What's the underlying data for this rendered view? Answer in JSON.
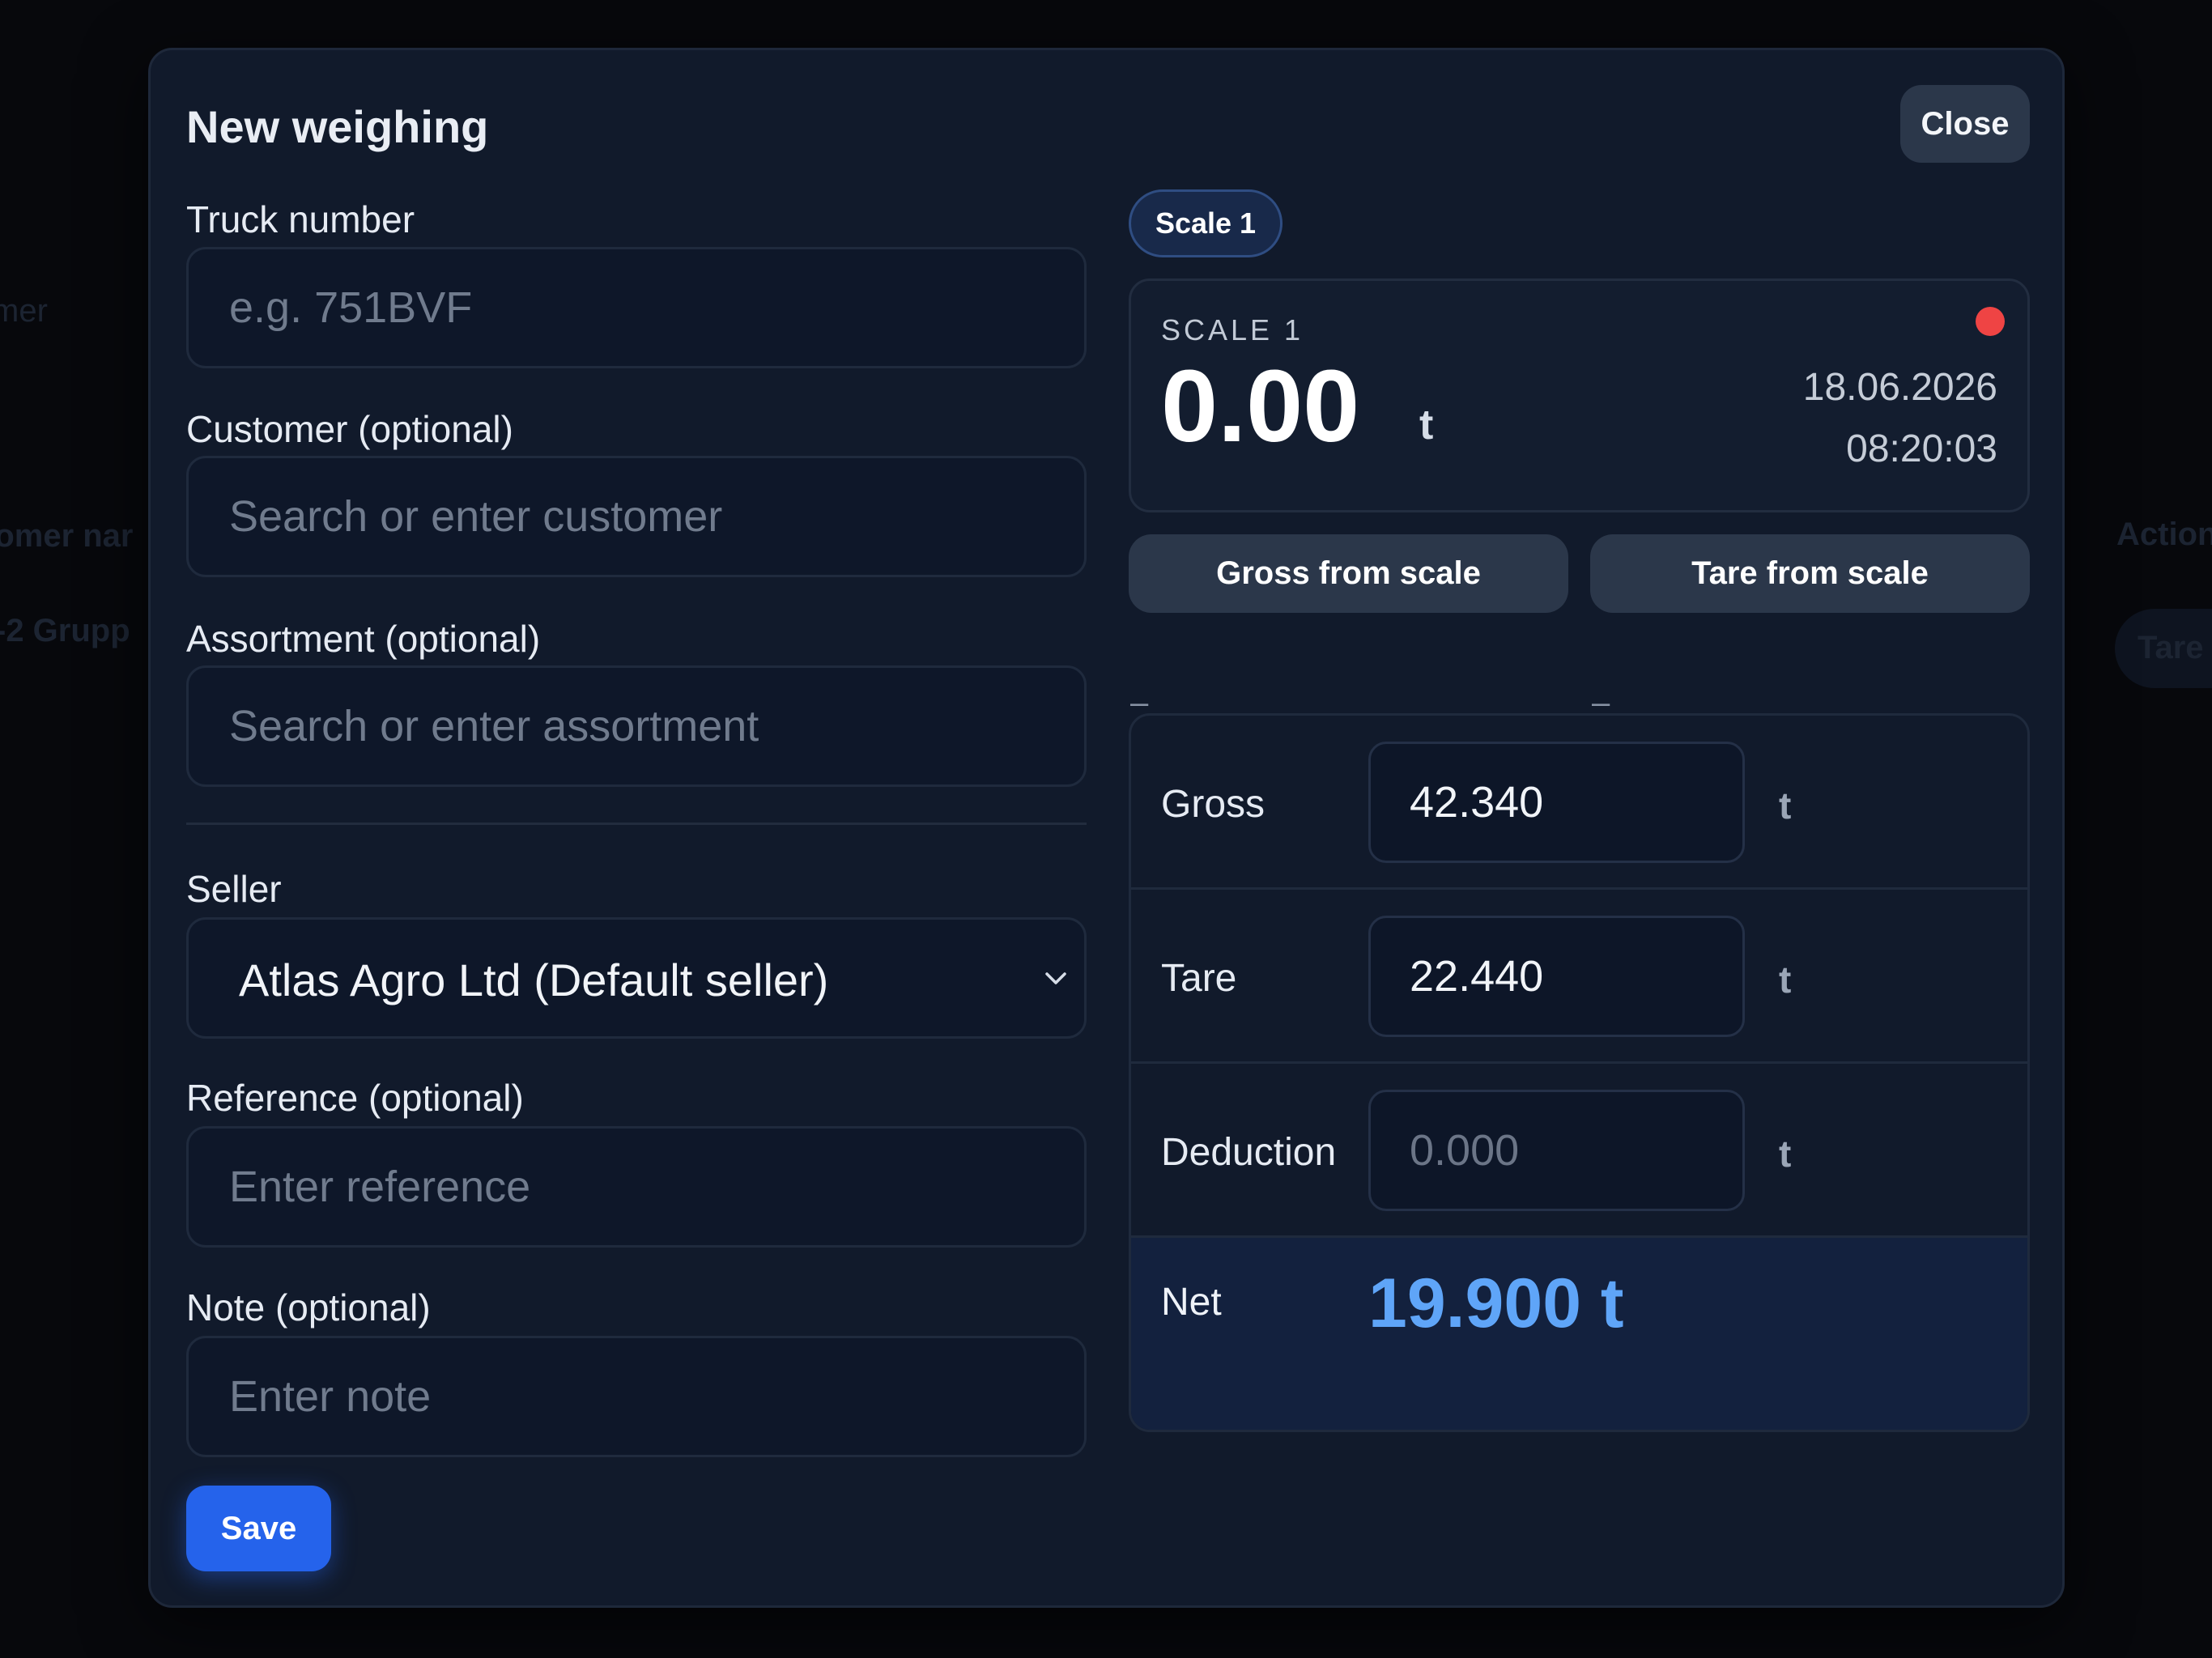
{
  "background": {
    "fragments": [
      "mer",
      "tomer nar",
      "-2 Grupp",
      "Action",
      "Tare"
    ]
  },
  "modal": {
    "title": "New weighing",
    "close_label": "Close"
  },
  "form": {
    "truck": {
      "label": "Truck number",
      "placeholder": "e.g. 751BVF",
      "value": ""
    },
    "customer": {
      "label": "Customer (optional)",
      "placeholder": "Search or enter customer",
      "value": ""
    },
    "assortment": {
      "label": "Assortment (optional)",
      "placeholder": "Search or enter assortment",
      "value": ""
    },
    "seller": {
      "label": "Seller",
      "selected": "Atlas Agro Ltd (Default seller)"
    },
    "reference": {
      "label": "Reference (optional)",
      "placeholder": "Enter reference",
      "value": ""
    },
    "note": {
      "label": "Note (optional)",
      "placeholder": "Enter note",
      "value": ""
    },
    "save_label": "Save"
  },
  "scale": {
    "tab_label": "Scale 1",
    "name": "SCALE 1",
    "weight": "0.00",
    "unit": "t",
    "date": "18.06.2026",
    "time": "08:20:03",
    "status_color": "#ef4444",
    "gross_button": "Gross from scale",
    "tare_button": "Tare from scale",
    "gross_captured": "–",
    "tare_captured": "–"
  },
  "weights": {
    "gross": {
      "label": "Gross",
      "value": "42.340",
      "placeholder": "",
      "unit": "t"
    },
    "tare": {
      "label": "Tare",
      "value": "22.440",
      "placeholder": "",
      "unit": "t"
    },
    "deduction": {
      "label": "Deduction",
      "value": "",
      "placeholder": "0.000",
      "unit": "t"
    },
    "net": {
      "label": "Net",
      "value": "19.900 t"
    }
  },
  "colors": {
    "accent": "#2563eb",
    "net_value": "#5fa5f8",
    "modal_bg": "#111a2b"
  }
}
